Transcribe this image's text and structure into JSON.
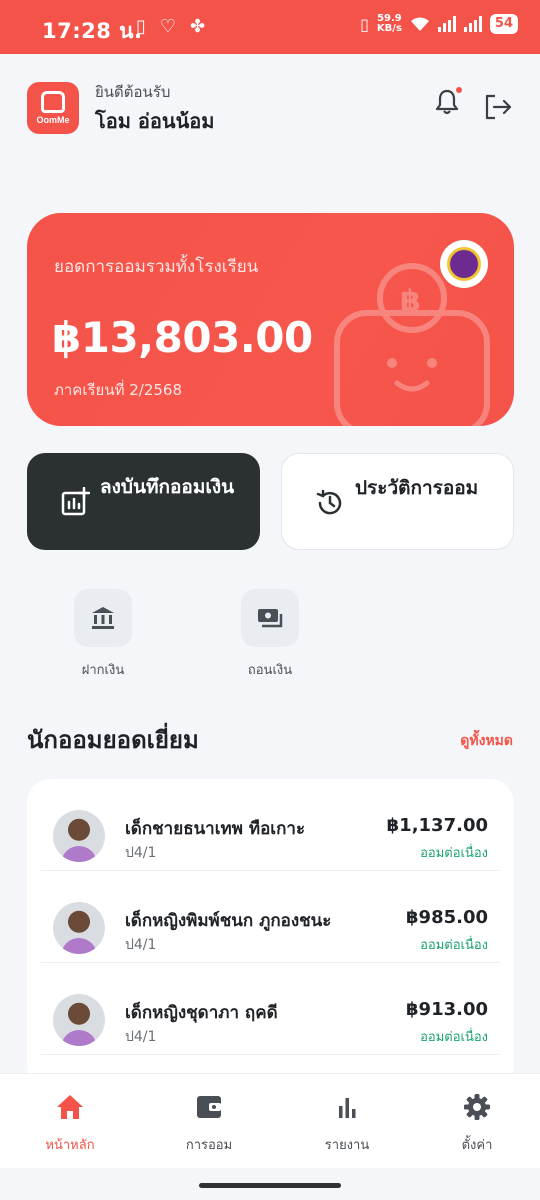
{
  "status_bar": {
    "time": "17:28 น.",
    "net_speed": "59.9",
    "net_unit": "KB/s",
    "battery": "54"
  },
  "header": {
    "logo_text": "OomMe",
    "welcome": "ยินดีต้อนรับ",
    "user_name": "โอม อ่อนน้อม",
    "has_notification": true
  },
  "balance_card": {
    "label": "ยอดการออมรวมทั้งโรงเรียน",
    "amount": "฿13,803.00",
    "term": "ภาคเรียนที่ 2/2568"
  },
  "actions": {
    "record_label": "ลงบันทึกออมเงิน",
    "history_label": "ประวัติการออม"
  },
  "quick_actions": [
    {
      "label": "ฝากเงิน",
      "icon": "bank-icon"
    },
    {
      "label": "ถอนเงิน",
      "icon": "withdraw-icon"
    }
  ],
  "top_savers": {
    "title": "นักออมยอดเยี่ยม",
    "see_all": "ดูทั้งหมด",
    "items": [
      {
        "name": "เด็กชายธนาเทพ ทือเกาะ",
        "class": "ป4/1",
        "amount": "฿1,137.00",
        "status": "ออมต่อเนื่อง"
      },
      {
        "name": "เด็กหญิงพิมพ์ชนก ภูกองชนะ",
        "class": "ป4/1",
        "amount": "฿985.00",
        "status": "ออมต่อเนื่อง"
      },
      {
        "name": "เด็กหญิงชุดาภา ฤคดี",
        "class": "ป4/1",
        "amount": "฿913.00",
        "status": "ออมต่อเนื่อง"
      }
    ]
  },
  "bottom_nav": [
    {
      "label": "หน้าหลัก",
      "icon": "home-icon",
      "active": true
    },
    {
      "label": "การออม",
      "icon": "wallet-icon",
      "active": false
    },
    {
      "label": "รายงาน",
      "icon": "bar-chart-icon",
      "active": false
    },
    {
      "label": "ตั้งค่า",
      "icon": "gear-icon",
      "active": false
    }
  ],
  "colors": {
    "accent": "#f4534a",
    "dark_button": "#2b3133",
    "success": "#1aa36b"
  }
}
